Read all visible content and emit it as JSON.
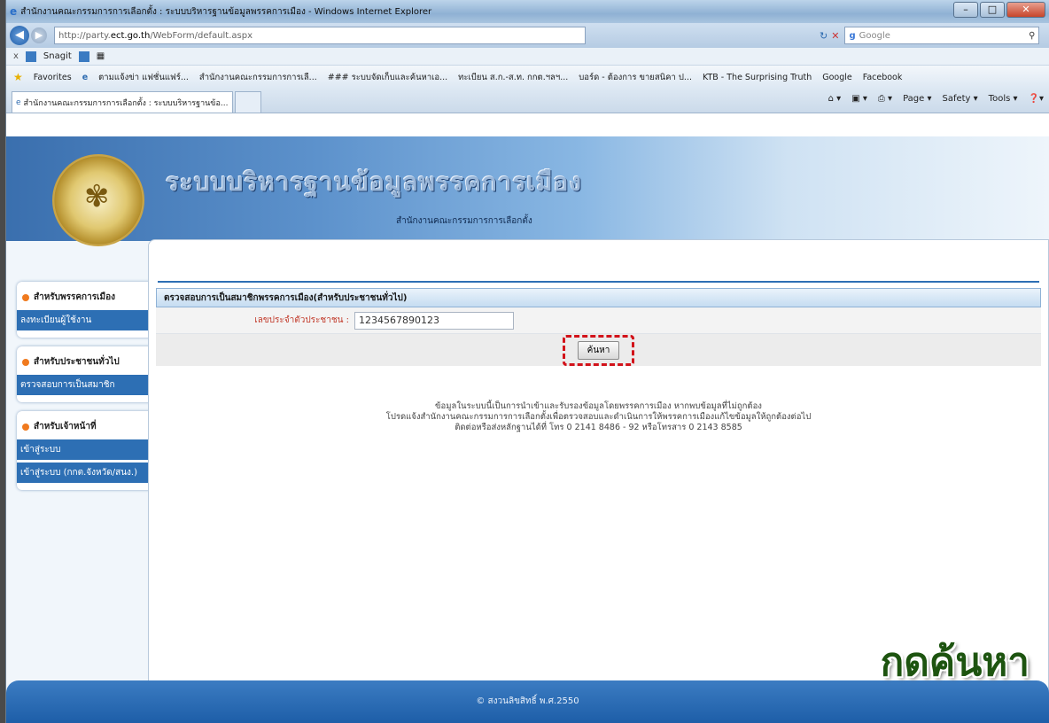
{
  "window": {
    "title": "สำนักงานคณะกรรมการการเลือกตั้ง : ระบบบริหารฐานข้อมูลพรรคการเมือง - Windows Internet Explorer"
  },
  "address_bar": {
    "url_prefix": "http://party.",
    "url_domain": "ect.go.th",
    "url_path": "/WebForm/default.aspx",
    "search_placeholder": "Google"
  },
  "snagit": {
    "close": "x",
    "label": "Snagit"
  },
  "favorites": {
    "label": "Favorites",
    "items": [
      "ตามแจ้งข่า แฟชั่นแฟร์...",
      "สำนักงานคณะกรรมการการเลื...",
      "### ระบบจัดเก็บและค้นหาเอ...",
      "ทะเบียน ส.ก.-ส.ท. กกต.ฯลฯ...",
      "บอร์ด - ต้องการ ขายสนิคา ป...",
      "KTB - The Surprising Truth",
      "Google",
      "Facebook"
    ]
  },
  "tab": {
    "label": "สำนักงานคณะกรรมการการเลือกตั้ง : ระบบบริหารฐานข้อ..."
  },
  "command_bar": {
    "page": "Page ▾",
    "safety": "Safety ▾",
    "tools": "Tools ▾"
  },
  "banner": {
    "title": "ระบบบริหารฐานข้อมูลพรรคการเมือง",
    "subtitle": "สำนักงานคณะกรรมการการเลือกตั้ง"
  },
  "sidebar": {
    "groups": [
      {
        "heading": "สำหรับพรรคการเมือง",
        "links": [
          "ลงทะเบียนผู้ใช้งาน"
        ]
      },
      {
        "heading": "สำหรับประชาชนทั่วไป",
        "links": [
          "ตรวจสอบการเป็นสมาชิก"
        ]
      },
      {
        "heading": "สำหรับเจ้าหน้าที่",
        "links": [
          "เข้าสู่ระบบ",
          "เข้าสู่ระบบ (กกต.จังหวัด/สนง.)"
        ]
      }
    ]
  },
  "form": {
    "heading": "ตรวจสอบการเป็นสมาชิกพรรคการเมือง(สำหรับประชาชนทั่วไป)",
    "id_label": "เลขประจำตัวประชาชน :",
    "id_value": "1234567890123",
    "search_button": "ค้นหา"
  },
  "notice": {
    "line1": "ข้อมูลในระบบนี้เป็นการนำเข้าและรับรองข้อมูลโดยพรรคการเมือง หากพบข้อมูลที่ไม่ถูกต้อง",
    "line2": "โปรดแจ้งสำนักงานคณะกรรมการการเลือกตั้งเพื่อตรวจสอบและดำเนินการให้พรรคการเมืองแก้ไขข้อมูลให้ถูกต้องต่อไป",
    "line3": "ติดต่อหรือส่งหลักฐานได้ที่ โทร 0 2141 8486 - 92 หรือโทรสาร 0 2143 8585"
  },
  "footer": {
    "copyright": "© สงวนลิขสิทธิ์ พ.ศ.2550"
  },
  "annotation": {
    "text": "กดค้นหา"
  },
  "colors": {
    "accent": "#2d6fb4",
    "highlight": "#d2121a",
    "annotation": "#1d5410"
  }
}
